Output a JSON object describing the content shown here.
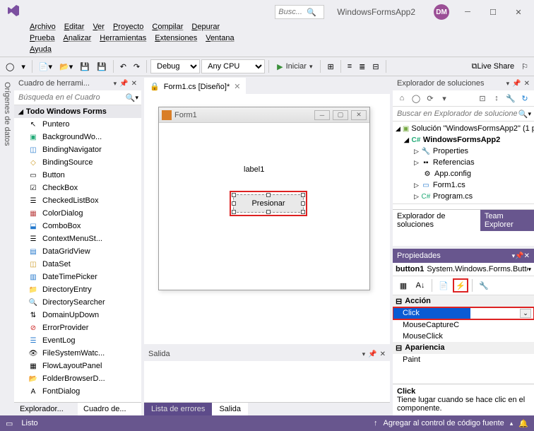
{
  "titlebar": {
    "search_placeholder": "Busc...",
    "app_name": "WindowsFormsApp2",
    "user_initials": "DM"
  },
  "menu": [
    "Archivo",
    "Editar",
    "Ver",
    "Proyecto",
    "Compilar",
    "Depurar",
    "Prueba",
    "Analizar",
    "Herramientas",
    "Extensiones",
    "Ventana",
    "Ayuda"
  ],
  "toolbar": {
    "config": "Debug",
    "platform": "Any CPU",
    "start": "Iniciar",
    "liveshare": "Live Share"
  },
  "sidetab": "Orígenes de datos",
  "toolbox": {
    "title": "Cuadro de herrami...",
    "search_placeholder": "Búsqueda en el Cuadro",
    "group": "Todo Windows Forms",
    "items": [
      "Puntero",
      "BackgroundWo...",
      "BindingNavigator",
      "BindingSource",
      "Button",
      "CheckBox",
      "CheckedListBox",
      "ColorDialog",
      "ComboBox",
      "ContextMenuSt...",
      "DataGridView",
      "DataSet",
      "DateTimePicker",
      "DirectoryEntry",
      "DirectorySearcher",
      "DomainUpDown",
      "ErrorProvider",
      "EventLog",
      "FileSystemWatc...",
      "FlowLayoutPanel",
      "FolderBrowserD...",
      "FontDialog"
    ],
    "bottom_tabs": [
      "Explorador...",
      "Cuadro de..."
    ]
  },
  "doc_tab": {
    "label": "Form1.cs [Diseño]*"
  },
  "designer": {
    "form_title": "Form1",
    "label_text": "label1",
    "button_text": "Presionar"
  },
  "salida": {
    "title": "Salida",
    "tabs": [
      "Lista de errores",
      "Salida"
    ]
  },
  "solution": {
    "title": "Explorador de soluciones",
    "search_placeholder": "Buscar en Explorador de soluciones",
    "root": "Solución \"WindowsFormsApp2\" (1 p",
    "project": "WindowsFormsApp2",
    "nodes": [
      "Properties",
      "Referencias",
      "App.config",
      "Form1.cs",
      "Program.cs"
    ],
    "bottom_tabs": [
      "Explorador de soluciones",
      "Team Explorer"
    ]
  },
  "props": {
    "title": "Propiedades",
    "target_name": "button1",
    "target_type": "System.Windows.Forms.Butto",
    "cat1": "Acción",
    "rows1": [
      "Click",
      "MouseCaptureC",
      "MouseClick"
    ],
    "cat2": "Apariencia",
    "rows2": [
      "Paint"
    ],
    "desc_name": "Click",
    "desc_text": "Tiene lugar cuando se hace clic en el componente."
  },
  "status": {
    "left": "Listo",
    "right": "Agregar al control de código fuente"
  }
}
